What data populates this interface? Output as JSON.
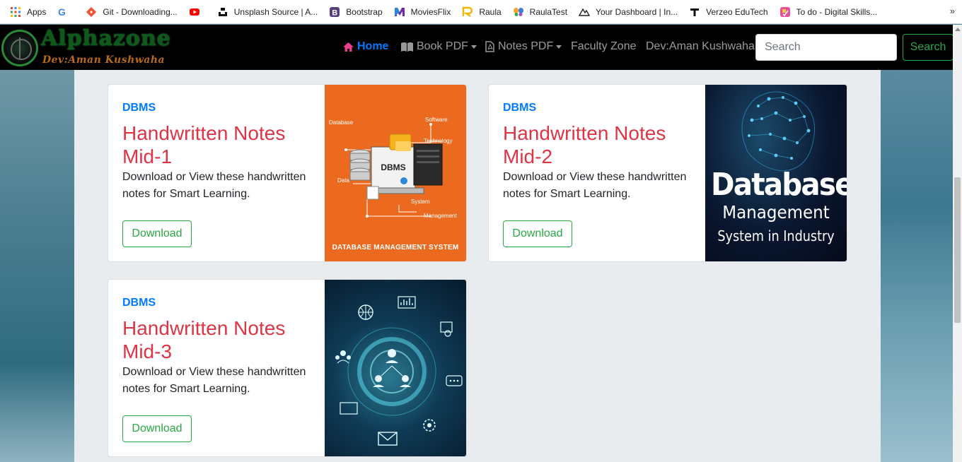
{
  "bookmarks": [
    {
      "label": "Apps",
      "icon": "apps-grid-icon"
    },
    {
      "label": "",
      "icon": "google-icon"
    },
    {
      "label": "Git - Downloading...",
      "icon": "git-icon"
    },
    {
      "label": "",
      "icon": "youtube-icon"
    },
    {
      "label": "Unsplash Source | A...",
      "icon": "unsplash-icon"
    },
    {
      "label": "Bootstrap",
      "icon": "bootstrap-icon"
    },
    {
      "label": "MoviesFlix",
      "icon": "moviesflix-icon"
    },
    {
      "label": "Raula",
      "icon": "raula-icon"
    },
    {
      "label": "RaulaTest",
      "icon": "butterfly-icon"
    },
    {
      "label": "Your Dashboard | In...",
      "icon": "dashboard-icon"
    },
    {
      "label": "Verzeo EduTech",
      "icon": "verzeo-icon"
    },
    {
      "label": "To do - Digital Skills...",
      "icon": "todo-icon"
    }
  ],
  "bookmarks_more": "»",
  "brand": {
    "name": "Alphazone",
    "sub": "Dev:Aman Kushwaha"
  },
  "nav": {
    "home": "Home",
    "book_pdf": "Book PDF",
    "notes_pdf": "Notes PDF",
    "faculty": "Faculty Zone",
    "dev": "Dev:Aman Kushwaha"
  },
  "search": {
    "placeholder": "Search",
    "button": "Search"
  },
  "cards": [
    {
      "tag": "DBMS",
      "title": "Handwritten Notes Mid-1",
      "text": "Download or View these handwritten notes for Smart Learning.",
      "button": "Download",
      "image": {
        "center": "DBMS",
        "labels": [
          "Database",
          "Software",
          "Technology",
          "Data",
          "System",
          "Management"
        ],
        "footer": "DATABASE MANAGEMENT SYSTEM"
      }
    },
    {
      "tag": "DBMS",
      "title": "Handwritten Notes Mid-2",
      "text": "Download or View these handwritten notes for Smart Learning.",
      "button": "Download",
      "image": {
        "line1": "Database",
        "line2": "Management",
        "line3": "System in Industry"
      }
    },
    {
      "tag": "DBMS",
      "title": "Handwritten Notes Mid-3",
      "text": "Download or View these handwritten notes for Smart Learning.",
      "button": "Download",
      "image": {}
    }
  ],
  "colors": {
    "link_blue": "#007bff",
    "title_red": "#dc3545",
    "btn_green": "#28a745",
    "navbar": "#000000",
    "page_bg": "#e9ecef"
  }
}
